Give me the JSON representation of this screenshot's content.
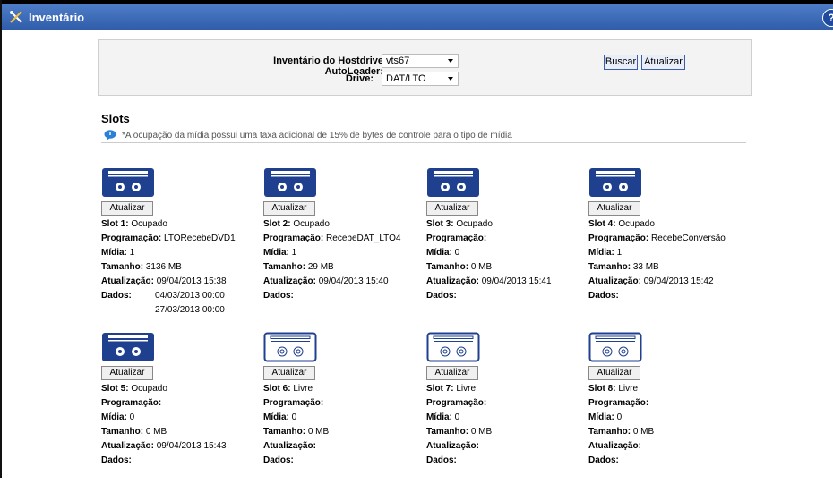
{
  "window": {
    "title": "Inventário",
    "help": "?"
  },
  "filters": {
    "autoloader_label": "Inventário do Hostdrive AutoLoader:",
    "autoloader_value": "vts67",
    "drive_label": "Drive:",
    "drive_value": "DAT/LTO",
    "search_label": "Buscar",
    "refresh_label": "Atualizar"
  },
  "slots_section": {
    "heading": "Slots",
    "note": "*A ocupação da mídia possui uma taxa adicional de 15% de bytes de controle para o tipo de mídia"
  },
  "labels": {
    "update_button": "Atualizar",
    "programacao": "Programação:",
    "midia": "Mídia:",
    "tamanho": "Tamanho:",
    "atualizacao": "Atualização:",
    "dados": "Dados:"
  },
  "slots": [
    {
      "slot_label": "Slot 1:",
      "status": "Ocupado",
      "occupied": true,
      "programacao": "LTORecebeDVD1",
      "midia": "1",
      "tamanho": "3136 MB",
      "atualizacao": "09/04/2013 15:38",
      "dados": [
        "04/03/2013 00:00",
        "27/03/2013 00:00"
      ]
    },
    {
      "slot_label": "Slot 2:",
      "status": "Ocupado",
      "occupied": true,
      "programacao": "RecebeDAT_LTO4",
      "midia": "1",
      "tamanho": "29 MB",
      "atualizacao": "09/04/2013 15:40",
      "dados": []
    },
    {
      "slot_label": "Slot 3:",
      "status": "Ocupado",
      "occupied": true,
      "programacao": "",
      "midia": "0",
      "tamanho": "0 MB",
      "atualizacao": "09/04/2013 15:41",
      "dados": []
    },
    {
      "slot_label": "Slot 4:",
      "status": "Ocupado",
      "occupied": true,
      "programacao": "RecebeConversão",
      "midia": "1",
      "tamanho": "33 MB",
      "atualizacao": "09/04/2013 15:42",
      "dados": []
    },
    {
      "slot_label": "Slot 5:",
      "status": "Ocupado",
      "occupied": true,
      "programacao": "",
      "midia": "0",
      "tamanho": "0 MB",
      "atualizacao": "09/04/2013 15:43",
      "dados": []
    },
    {
      "slot_label": "Slot 6:",
      "status": "Livre",
      "occupied": false,
      "programacao": "",
      "midia": "0",
      "tamanho": "0 MB",
      "atualizacao": "",
      "dados": []
    },
    {
      "slot_label": "Slot 7:",
      "status": "Livre",
      "occupied": false,
      "programacao": "",
      "midia": "0",
      "tamanho": "0 MB",
      "atualizacao": "",
      "dados": []
    },
    {
      "slot_label": "Slot 8:",
      "status": "Livre",
      "occupied": false,
      "programacao": "",
      "midia": "0",
      "tamanho": "0 MB",
      "atualizacao": "",
      "dados": []
    }
  ],
  "colors": {
    "titlebar": "#2f5ca8",
    "tape_occupied": "#1f3f8f",
    "tape_free_border": "#1f3f8f"
  }
}
